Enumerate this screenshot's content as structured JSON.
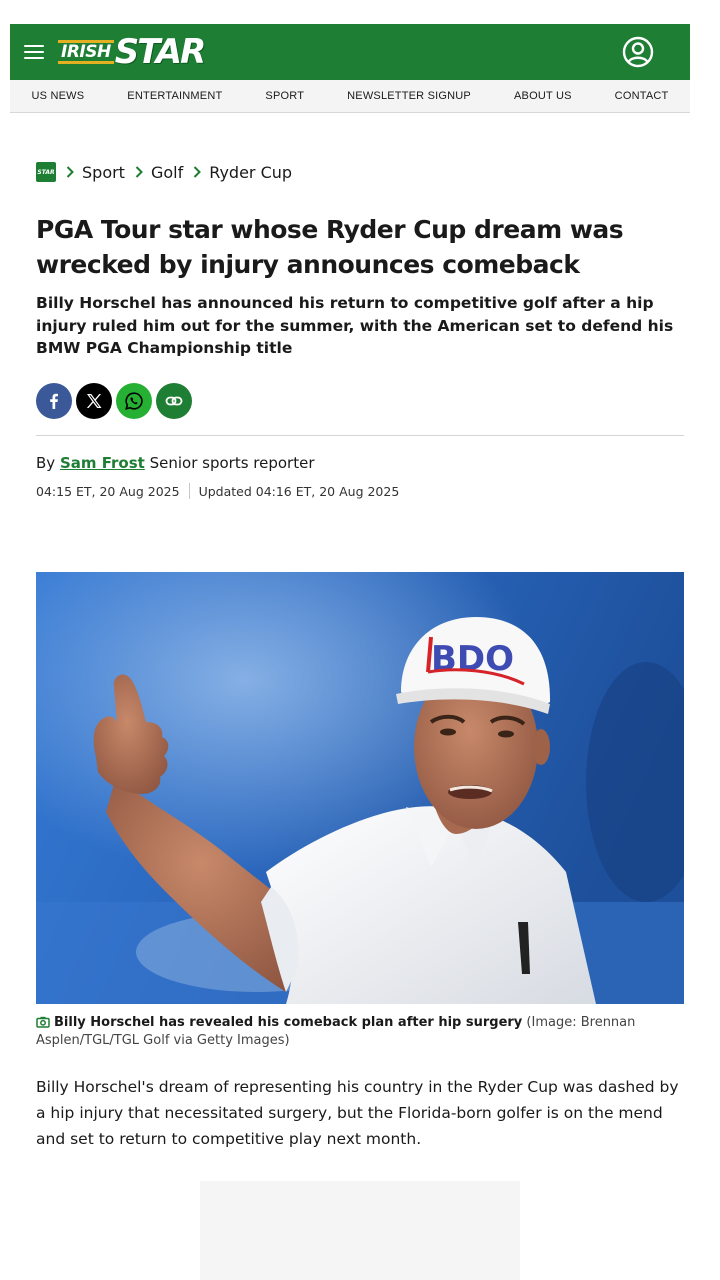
{
  "brand": {
    "name_top": "IRISH",
    "name_main": "STAR",
    "primary_color": "#1e7e34",
    "accent_color": "#e3b021"
  },
  "nav": {
    "items": [
      "US NEWS",
      "ENTERTAINMENT",
      "SPORT",
      "NEWSLETTER SIGNUP",
      "ABOUT US",
      "CONTACT"
    ]
  },
  "breadcrumb": {
    "items": [
      "Sport",
      "Golf",
      "Ryder Cup"
    ]
  },
  "article": {
    "headline": "PGA Tour star whose Ryder Cup dream was wrecked by injury announces comeback",
    "standfirst": "Billy Horschel has announced his return to competitive golf after a hip injury ruled him out for the summer, with the American set to defend his BMW PGA Championship title",
    "byline_prefix": "By",
    "author": "Sam Frost",
    "author_role": "Senior sports reporter",
    "published": "04:15 ET, 20 Aug 2025",
    "updated": "Updated 04:16 ET, 20 Aug 2025",
    "image_cap_logo": "BDO",
    "caption_main": "Billy Horschel has revealed his comeback plan after hip surgery",
    "caption_credit": "(Image: Brennan Asplen/TGL/TGL Golf via Getty Images)",
    "body_paragraph": "Billy Horschel's dream of representing his country in the Ryder Cup was dashed by a hip injury that necessitated surgery, but the Florida-born golfer is on the mend and set to return to competitive play next month."
  },
  "share": {
    "icons": [
      "facebook-icon",
      "x-icon",
      "whatsapp-icon",
      "link-icon"
    ]
  }
}
